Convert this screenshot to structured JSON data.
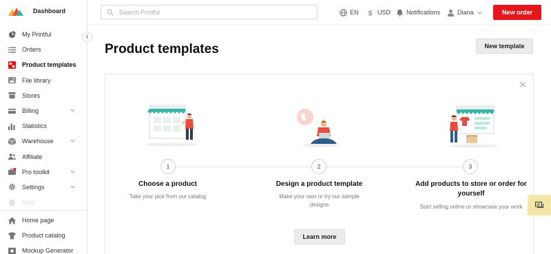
{
  "brand": {
    "title": "Dashboard"
  },
  "sidebar": {
    "items": [
      {
        "label": "My Printful",
        "icon": "pie-chart-icon",
        "has_chevron": false
      },
      {
        "label": "Orders",
        "icon": "list-icon",
        "has_chevron": false
      },
      {
        "label": "Product templates",
        "icon": "template-icon",
        "has_chevron": false,
        "active": true
      },
      {
        "label": "File library",
        "icon": "image-icon",
        "has_chevron": false
      },
      {
        "label": "Stores",
        "icon": "store-icon",
        "has_chevron": false
      },
      {
        "label": "Billing",
        "icon": "card-icon",
        "has_chevron": true
      },
      {
        "label": "Statistics",
        "icon": "bar-chart-icon",
        "has_chevron": false
      },
      {
        "label": "Warehouse",
        "icon": "box-icon",
        "has_chevron": true
      },
      {
        "label": "Affiliate",
        "icon": "people-icon",
        "has_chevron": false
      },
      {
        "label": "Pro toolkit",
        "icon": "toolkit-icon",
        "has_chevron": true
      },
      {
        "label": "Settings",
        "icon": "gear-icon",
        "has_chevron": true
      },
      {
        "label": "Help",
        "icon": "help-icon",
        "has_chevron": false,
        "faded": true
      }
    ],
    "bottom_items": [
      {
        "label": "Home page",
        "icon": "home-icon"
      },
      {
        "label": "Product catalog",
        "icon": "shirt-icon"
      },
      {
        "label": "Mockup Generator",
        "icon": "mockup-icon"
      }
    ]
  },
  "header": {
    "search_placeholder": "Search Printful",
    "language": "EN",
    "currency": "USD",
    "notifications": "Notifications",
    "user": "Diana",
    "new_order": "New order"
  },
  "main": {
    "title": "Product templates",
    "new_template": "New template",
    "steps": [
      {
        "number": "1",
        "title": "Choose a product",
        "description": "Take your pick from our catalog"
      },
      {
        "number": "2",
        "title": "Design a product template",
        "description": "Make your own or try our sample designs"
      },
      {
        "number": "3",
        "title": "Add products to store or order for yourself",
        "description": "Start selling online or showcase your work"
      }
    ],
    "learn_more": "Learn more"
  },
  "colors": {
    "accent_red": "#e8161b",
    "teal": "#35b5a5",
    "notification_dot": "#e8161b",
    "chat_bg": "#f5e6a8"
  }
}
